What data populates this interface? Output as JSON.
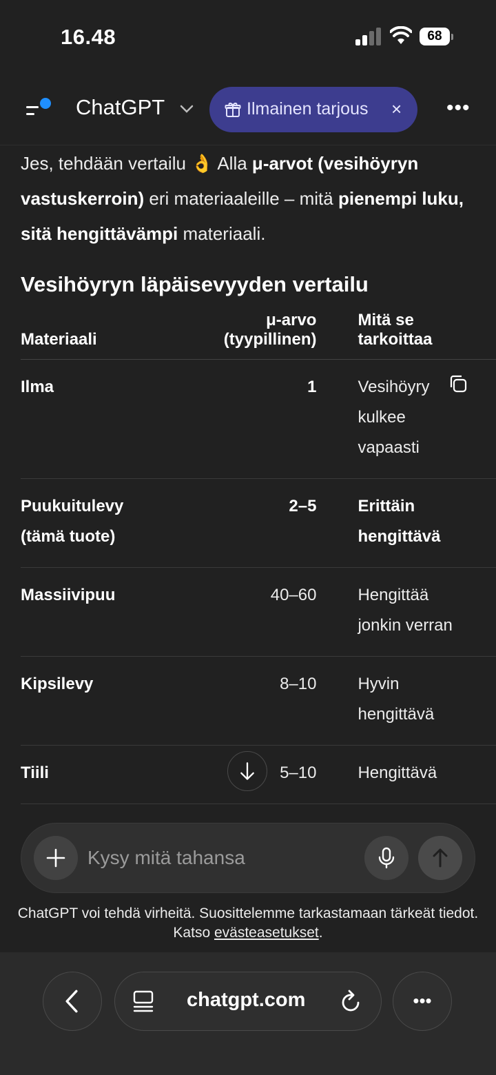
{
  "status_bar": {
    "time": "16.48",
    "battery": "68"
  },
  "header": {
    "title": "ChatGPT",
    "offer_label": "Ilmainen tarjous",
    "offer_close": "×",
    "more": "•••"
  },
  "message": {
    "intro_1": "Jes, tehdään vertailu ",
    "emoji": "👌",
    "intro_2": " Alla ",
    "intro_bold_1": "μ-arvot (vesihöyryn vastuskerroin)",
    "intro_3": " eri materiaaleille – mitä ",
    "intro_bold_2": "pienempi luku, sitä hengittävämpi",
    "intro_4": " materiaali.",
    "section_title": "Vesihöyryn läpäisevyyden vertailu",
    "table": {
      "headers": [
        "Materiaali",
        "μ-arvo (tyypillinen)",
        "Mitä se tarkoittaa"
      ],
      "rows": [
        {
          "material": "Ilma",
          "mu": "1",
          "meaning": "Vesihöyry kulkee vapaasti"
        },
        {
          "material": "Puukuitulevy (tämä tuote)",
          "mu": "2–5",
          "meaning": "Erittäin hengittävä"
        },
        {
          "material": "Massiivipuu",
          "mu": "40–60",
          "meaning": "Hengittää jonkin verran"
        },
        {
          "material": "Kipsilevy",
          "mu": "8–10",
          "meaning": "Hyvin hengittävä"
        },
        {
          "material": "Tiili",
          "mu": "5–10",
          "meaning": "Hengittävä"
        }
      ]
    }
  },
  "composer": {
    "placeholder": "Kysy mitä tahansa"
  },
  "disclaimer": {
    "text": "ChatGPT voi tehdä virheitä. Suosittelemme tarkastamaan tärkeät tiedot. Katso ",
    "link": "evästeasetukset",
    "end": "."
  },
  "browser": {
    "domain": "chatgpt.com",
    "more": "•••"
  }
}
